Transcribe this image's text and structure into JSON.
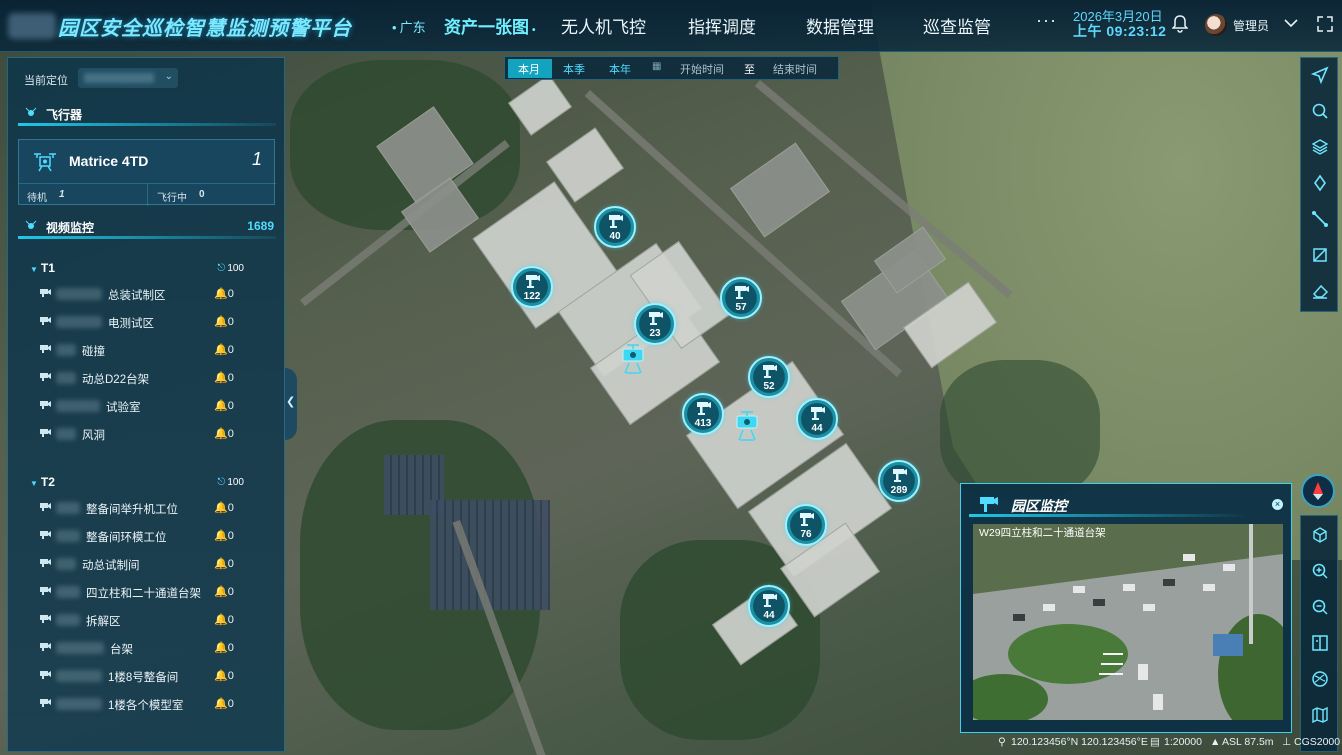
{
  "header": {
    "title": "园区安全巡检智慧监测预警平台",
    "region": "广东",
    "nav": [
      {
        "label": "资产一张图",
        "active": true
      },
      {
        "label": "无人机飞控",
        "active": false
      },
      {
        "label": "指挥调度",
        "active": false
      },
      {
        "label": "数据管理",
        "active": false
      },
      {
        "label": "巡查监管",
        "active": false
      }
    ],
    "more": "···",
    "date": "2026年3月20日",
    "time": "上午 09:23:12",
    "user": "管理员",
    "icons": [
      "bell-icon",
      "avatar",
      "chevron-down-icon",
      "fullscreen-icon"
    ]
  },
  "sidebar": {
    "location_label": "当前定位",
    "aircraft_title": "飞行器",
    "drone": {
      "model": "Matrice 4TD",
      "count": "1",
      "standby_label": "待机",
      "standby_count": "1",
      "flying_label": "飞行中",
      "flying_count": "0"
    },
    "video_title": "视频监控",
    "video_total": "1689",
    "groups": [
      {
        "name": "T1",
        "alarm": "100",
        "items": [
          {
            "name": "总装试制区",
            "alarm": "0"
          },
          {
            "name": "电测试区",
            "alarm": "0"
          },
          {
            "name": "碰撞",
            "alarm": "0"
          },
          {
            "name": "动总D22台架",
            "alarm": "0"
          },
          {
            "name": "试验室",
            "alarm": "0"
          },
          {
            "name": "风洞",
            "alarm": "0"
          }
        ]
      },
      {
        "name": "T2",
        "alarm": "100",
        "items": [
          {
            "name": "整备间举升机工位",
            "alarm": "0"
          },
          {
            "name": "整备间环模工位",
            "alarm": "0"
          },
          {
            "name": "动总试制间",
            "alarm": "0"
          },
          {
            "name": "四立柱和二十通道台架",
            "alarm": "0"
          },
          {
            "name": "拆解区",
            "alarm": "0"
          },
          {
            "name": "台架",
            "alarm": "0"
          },
          {
            "name": "1楼8号整备间",
            "alarm": "0"
          },
          {
            "name": "1楼各个模型室",
            "alarm": "0"
          }
        ]
      }
    ]
  },
  "timefilter": {
    "options": [
      "本月",
      "本季",
      "本年"
    ],
    "active": "本月",
    "start_placeholder": "开始时间",
    "separator": "至",
    "end_placeholder": "结束时间"
  },
  "map": {
    "markers": [
      "40",
      "122",
      "57",
      "23",
      "52",
      "413",
      "44",
      "289",
      "76",
      "44"
    ],
    "drones": 2
  },
  "right_toolbar_top": [
    "navigate-icon",
    "search-icon",
    "layers-icon",
    "diamond-icon",
    "measure-line-icon",
    "measure-area-icon",
    "eraser-icon"
  ],
  "right_toolbar_bottom": [
    "3d-cube-icon",
    "zoom-in-icon",
    "zoom-out-icon",
    "split-icon",
    "globe-icon",
    "map-icon"
  ],
  "video_popup": {
    "title": "园区监控",
    "camera": "W29四立柱和二十通道台架",
    "close": "×"
  },
  "statusbar": {
    "coords": "120.123456°N 120.123456°E",
    "scale": "1:20000",
    "altitude": "ASL 87.5m",
    "crs": "CGS2000"
  }
}
